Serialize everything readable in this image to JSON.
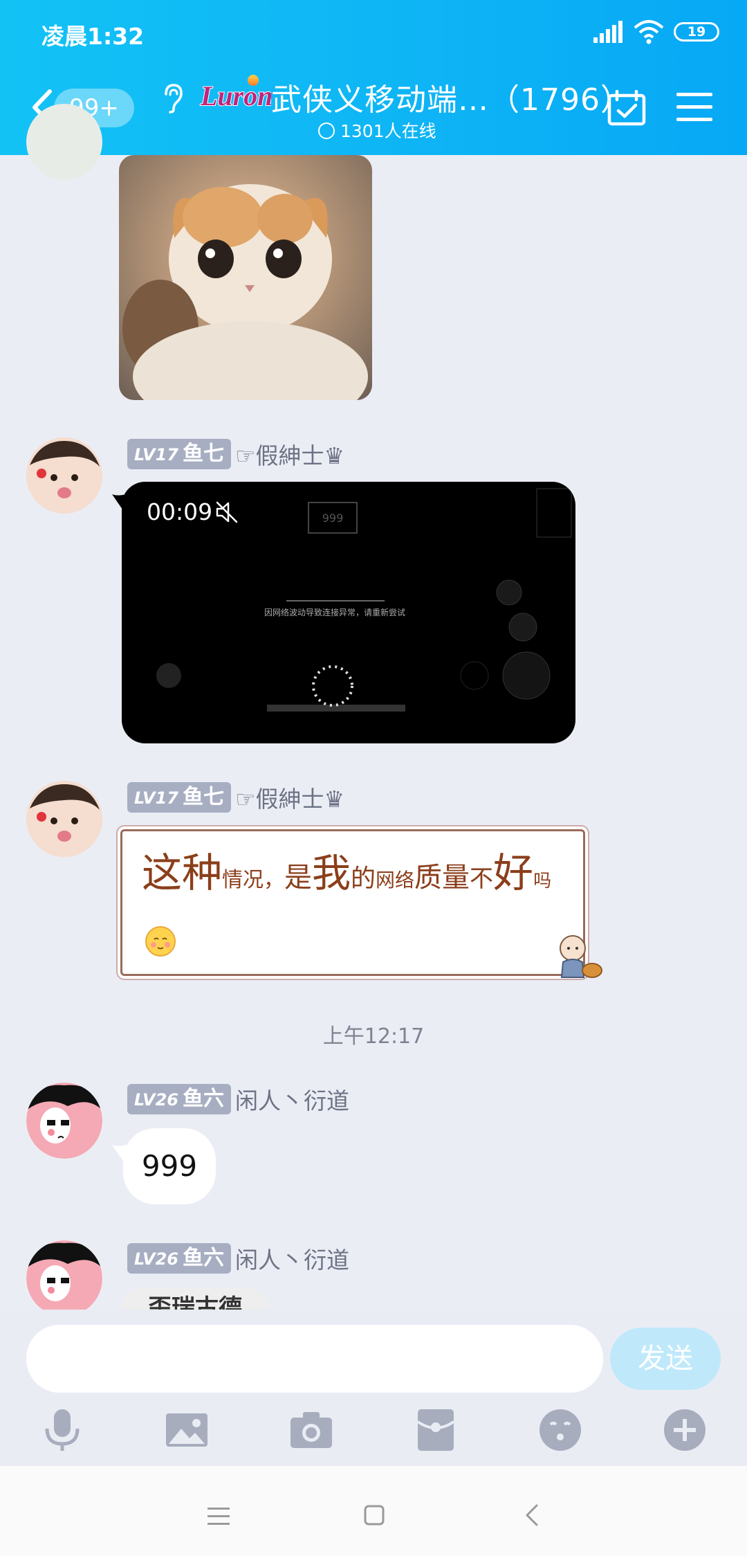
{
  "status_bar": {
    "time": "凌晨1:32",
    "battery": "19"
  },
  "header": {
    "unread_badge": "99+",
    "logo_text": "Luron",
    "group_title": "武侠义移动端…（1796）",
    "online_count": "1301人在线"
  },
  "messages": [
    {
      "level": "LV17",
      "nickname": "鱼七",
      "title": "☞假紳士♛",
      "video_duration": "00:09",
      "video_caption": "因网络波动导致连接异常，请重新尝试",
      "video_badge": "999"
    },
    {
      "level": "LV17",
      "nickname": "鱼七",
      "title": "☞假紳士♛",
      "text_parts": [
        "这种",
        "情况，",
        "是",
        "我",
        "的",
        "网络",
        "质量",
        "不",
        "好",
        "吗"
      ]
    },
    {
      "level": "LV26",
      "nickname": "鱼六",
      "title": "闲人丶衍道",
      "text": "999"
    },
    {
      "level": "LV26",
      "nickname": "鱼六",
      "title": "闲人丶衍道",
      "partial_text": "歪瑞古德"
    }
  ],
  "time_separator": "上午12:17",
  "input": {
    "placeholder": "",
    "send_label": "发送"
  },
  "toolbar": [
    "microphone-icon",
    "image-icon",
    "camera-icon",
    "red-packet-icon",
    "emoji-icon",
    "plus-icon"
  ],
  "colors": {
    "header": "#0fb6f5",
    "background": "#ebedf5",
    "level_badge": "#a7aec2",
    "send_button": "#bfe9fb"
  }
}
